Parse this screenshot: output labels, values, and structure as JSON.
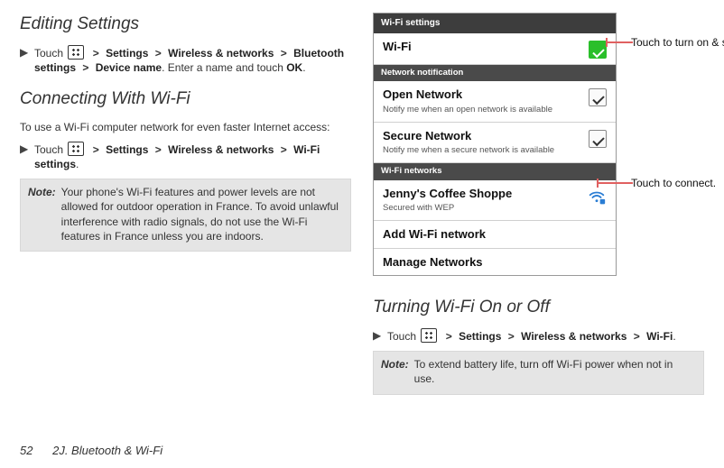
{
  "left": {
    "h_editing": "Editing Settings",
    "step_editing_prefix": "Touch",
    "gt": ">",
    "kw_settings": "Settings",
    "kw_wireless": "Wireless & networks",
    "kw_btsettings": "Bluetooth settings",
    "kw_devicename": "Device name",
    "step_editing_suffix": ". Enter a name and touch ",
    "kw_ok": "OK",
    "h_connecting": "Connecting With Wi-Fi",
    "body_connecting": "To use a Wi-Fi computer network for even faster Internet access:",
    "kw_wifisettings": "Wi-Fi settings",
    "note_label": "Note:",
    "note_body": "Your phone's Wi-Fi features and power levels are not allowed for outdoor operation in France. To avoid unlawful interference with radio signals, do not use the Wi-Fi features in France unless you are indoors."
  },
  "phone": {
    "header": "Wi-Fi settings",
    "row_wifi": "Wi-Fi",
    "sec_notif": "Network notification",
    "row_open_t": "Open Network",
    "row_open_s": "Notify me when an open network is available",
    "row_secure_t": "Secure Network",
    "row_secure_s": "Notify me when a secure network is available",
    "sec_networks": "Wi-Fi networks",
    "row_coffee_t": "Jenny's Coffee Shoppe",
    "row_coffee_s": "Secured with WEP",
    "row_add": "Add Wi-Fi network",
    "row_manage": "Manage Networks"
  },
  "callouts": {
    "scan": "Touch to turn on & scan.",
    "connect": "Touch to connect."
  },
  "right": {
    "h_turning": "Turning Wi-Fi On or Off",
    "kw_wifi": "Wi-Fi",
    "note_label": "Note:",
    "note_body": "To extend battery life, turn off Wi-Fi power when not in use."
  },
  "footer": {
    "page": "52",
    "section": "2J. Bluetooth & Wi-Fi"
  }
}
